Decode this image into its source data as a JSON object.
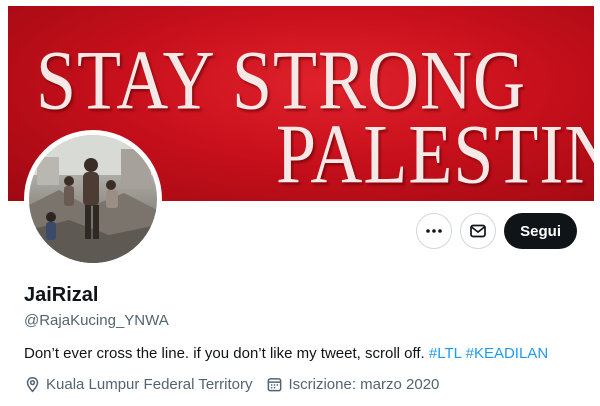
{
  "banner": {
    "line1": "STAY STRONG",
    "line2": "PALESTINE",
    "color": "#c8101c"
  },
  "avatar": {
    "icon": "avatar-photo"
  },
  "actions": {
    "more_icon": "more-horizontal-icon",
    "message_icon": "mail-icon",
    "follow_label": "Segui"
  },
  "profile": {
    "name": "JaiRizal",
    "handle": "@RajaKucing_YNWA",
    "bio_text": "Don’t ever cross the line. if you don’t like my tweet, scroll off.",
    "hashtags": [
      "#LTL",
      "#KEADILAN"
    ],
    "location": "Kuala Lumpur Federal Territory",
    "joined": "Iscrizione: marzo 2020"
  },
  "colors": {
    "accent": "#1d9bf0",
    "text": "#0f1419",
    "secondary": "#536471"
  }
}
